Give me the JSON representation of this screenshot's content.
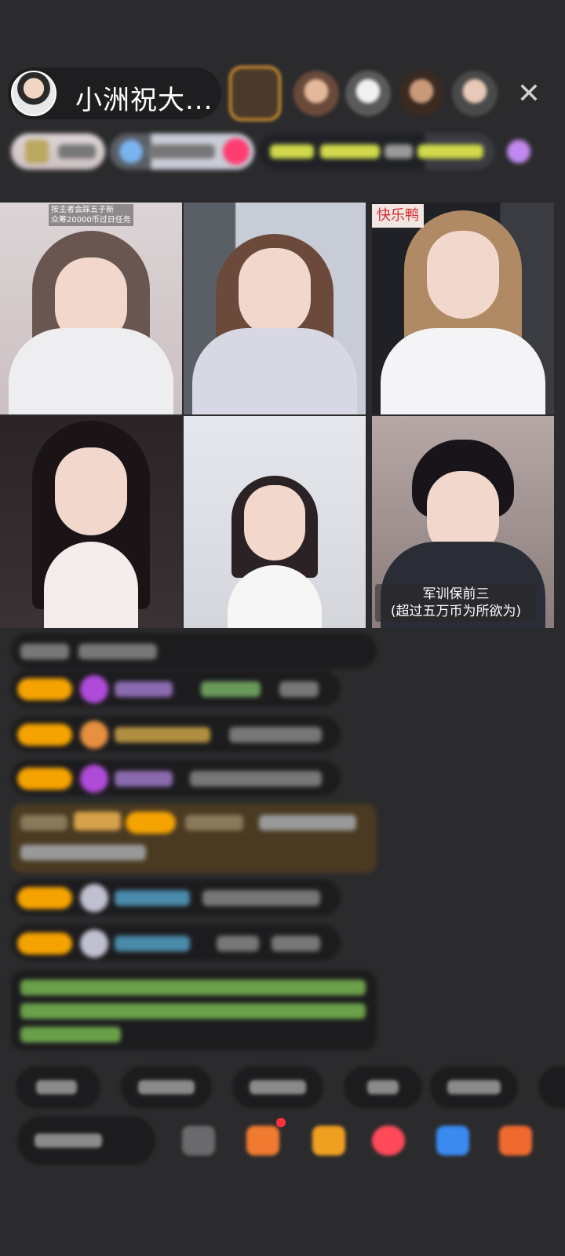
{
  "header": {
    "host_name": "小洲祝大...",
    "close_icon": "close-icon"
  },
  "grid": {
    "cells": [
      {
        "tag_line1": "按主者会踩五子新",
        "tag_line2": "众筹20000币过日任务"
      },
      {},
      {
        "tag": "快乐鸭"
      },
      {},
      {},
      {
        "caption_line1": "军训保前三",
        "caption_line2": "(超过五万币为所欲为)"
      }
    ]
  },
  "colors": {
    "background": "#2b2b2d",
    "level_badge": "#f5a300",
    "chip_background": "#1c1c1e",
    "tag_red": "#d42a2a"
  }
}
